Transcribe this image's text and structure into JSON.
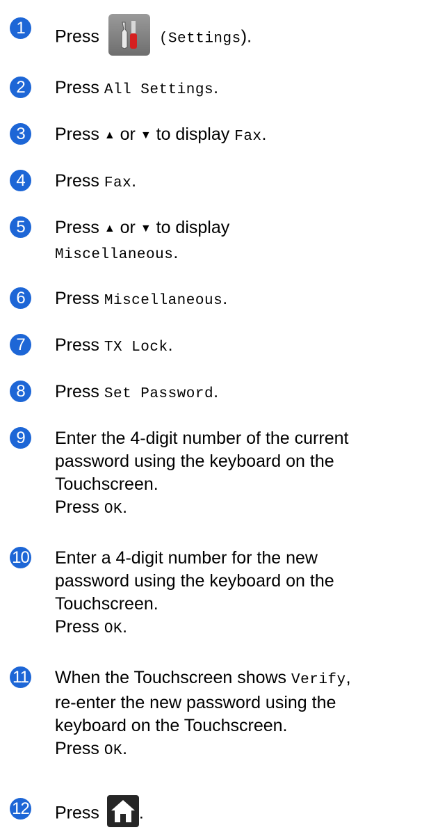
{
  "steps": [
    {
      "n": "1",
      "press": "Press",
      "paren_open": "(",
      "settings": "Settings",
      "paren_close": ")."
    },
    {
      "n": "2",
      "press": "Press",
      "code": "All Settings",
      "end": "."
    },
    {
      "n": "3",
      "press": "Press",
      "up": "▲",
      "or": "or",
      "down": "▼",
      "to_display": "to display",
      "code": "Fax",
      "end": "."
    },
    {
      "n": "4",
      "press": "Press",
      "code": "Fax",
      "end": "."
    },
    {
      "n": "5",
      "press": "Press",
      "up": "▲",
      "or": "or",
      "down": "▼",
      "to_display": "to display",
      "code": "Miscellaneous",
      "end": "."
    },
    {
      "n": "6",
      "press": "Press",
      "code": "Miscellaneous",
      "end": "."
    },
    {
      "n": "7",
      "press": "Press",
      "code": "TX Lock",
      "end": "."
    },
    {
      "n": "8",
      "press": "Press",
      "code": "Set Password",
      "end": "."
    },
    {
      "n": "9",
      "lines": [
        "Enter the 4-digit number of the current",
        "password using the keyboard on the",
        "Touchscreen."
      ],
      "press": "Press",
      "code": "OK",
      "end": "."
    },
    {
      "n": "10",
      "lines": [
        "Enter a 4-digit number for the new",
        "password using the keyboard on the",
        "Touchscreen."
      ],
      "press": "Press",
      "code": "OK",
      "end": "."
    },
    {
      "n": "11",
      "intro": "When the Touchscreen shows",
      "verify": "Verify",
      "comma": ",",
      "lines": [
        "re-enter the new password using the",
        "keyboard on the Touchscreen."
      ],
      "press": "Press",
      "code": "OK",
      "end": "."
    },
    {
      "n": "12",
      "press": "Press",
      "end": "."
    }
  ],
  "icons": {
    "settings": "settings-tools-icon",
    "home": "home-icon"
  },
  "colors": {
    "step_badge": "#1d66d6",
    "settings_icon_bg": "#7f7f7f",
    "home_icon_bg": "#262626"
  }
}
